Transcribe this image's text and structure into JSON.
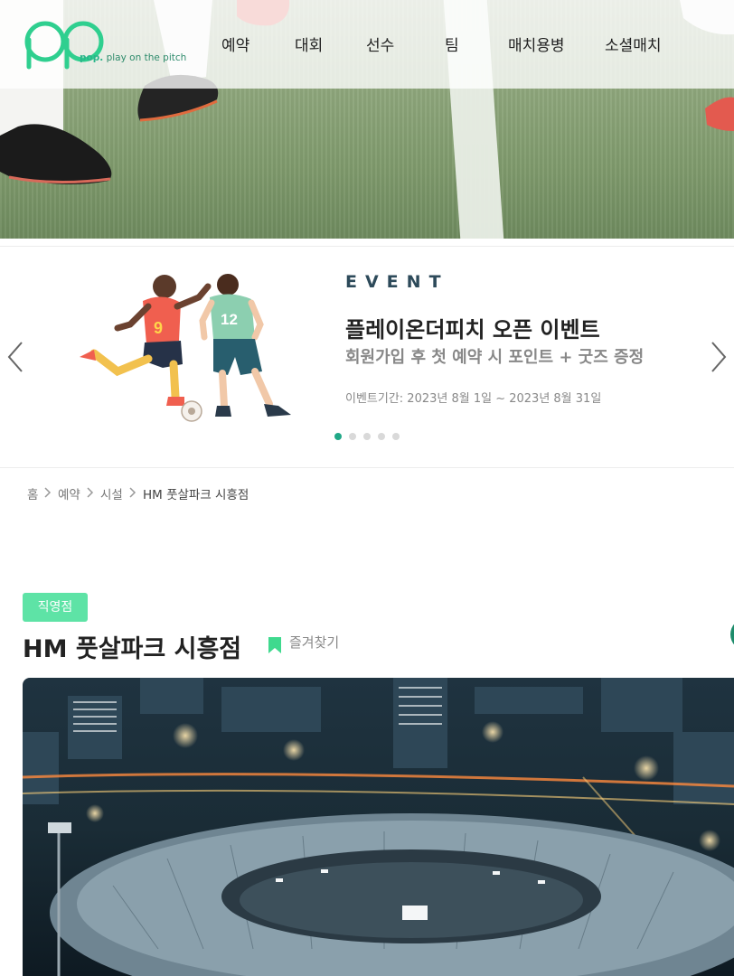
{
  "header": {
    "logo_text_brand": "pop.",
    "logo_text_tagline": "play on the pitch",
    "nav": [
      "예약",
      "대회",
      "선수",
      "팀",
      "매치용병",
      "소셜매치"
    ]
  },
  "event_banner": {
    "kicker": "EVENT",
    "title": "플레이온더피치 오픈 이벤트",
    "subtitle": "회원가입 후 첫 예약 시 포인트 + 굿즈 증정",
    "period": "이벤트기간: 2023년 8월 1일 ~ 2023년 8월 31일",
    "slide_count": 5,
    "active_slide": 1,
    "player_numbers": [
      "9",
      "12"
    ]
  },
  "breadcrumb": [
    "홈",
    "예약",
    "시설",
    "HM 풋살파크 시흥점"
  ],
  "facility": {
    "badge": "직영점",
    "name": "HM 풋살파크 시흥점",
    "favorite_label": "즐겨찾기"
  },
  "colors": {
    "brand_green": "#20a887",
    "badge_green": "#5ee3a6",
    "kicker_navy": "#2d4a5a"
  },
  "icons": [
    "chevron-left-icon",
    "chevron-right-icon",
    "bookmark-icon",
    "breadcrumb-separator-icon"
  ]
}
